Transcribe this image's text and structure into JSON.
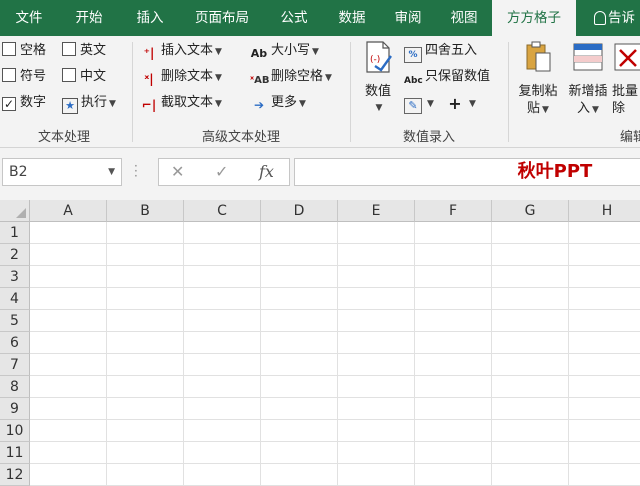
{
  "tabs": [
    {
      "label": "文件",
      "active": false
    },
    {
      "label": "开始",
      "active": false
    },
    {
      "label": "插入",
      "active": false
    },
    {
      "label": "页面布局",
      "active": false
    },
    {
      "label": "公式",
      "active": false
    },
    {
      "label": "数据",
      "active": false
    },
    {
      "label": "审阅",
      "active": false
    },
    {
      "label": "视图",
      "active": false
    },
    {
      "label": "方方格子",
      "active": true
    },
    {
      "label": "告诉",
      "active": false
    }
  ],
  "colors": {
    "brand": "#217346",
    "accent_text": "#c00000"
  },
  "ribbon": {
    "text_group": {
      "label": "文本处理",
      "checks": [
        {
          "label": "空格",
          "checked": false
        },
        {
          "label": "英文",
          "checked": false
        },
        {
          "label": "符号",
          "checked": false
        },
        {
          "label": "中文",
          "checked": false
        },
        {
          "label": "数字",
          "checked": true
        }
      ],
      "execute": "执行"
    },
    "adv_group": {
      "label": "高级文本处理",
      "insert_text": "插入文本",
      "delete_text": "删除文本",
      "extract_text": "截取文本",
      "case": "大小写",
      "delete_space": "删除空格",
      "more": "更多"
    },
    "num_group": {
      "label": "数值录入",
      "numeric": "数值",
      "round": "四舍五入",
      "keep_values": "只保留数值"
    },
    "edit_group": {
      "copy_paste_1": "复制粘",
      "copy_paste_2": "贴",
      "new_insert_1": "新增插",
      "new_insert_2": "入",
      "batch_del_1": "批量",
      "batch_del_2": "除",
      "label_partial": "编辑"
    }
  },
  "formula_bar": {
    "name_box": "B2",
    "value": "秋叶PPT"
  },
  "grid": {
    "columns": [
      "A",
      "B",
      "C",
      "D",
      "E",
      "F",
      "G",
      "H"
    ],
    "rows": [
      "1",
      "2",
      "3",
      "4",
      "5",
      "6",
      "7",
      "8",
      "9",
      "10",
      "11",
      "12"
    ]
  }
}
